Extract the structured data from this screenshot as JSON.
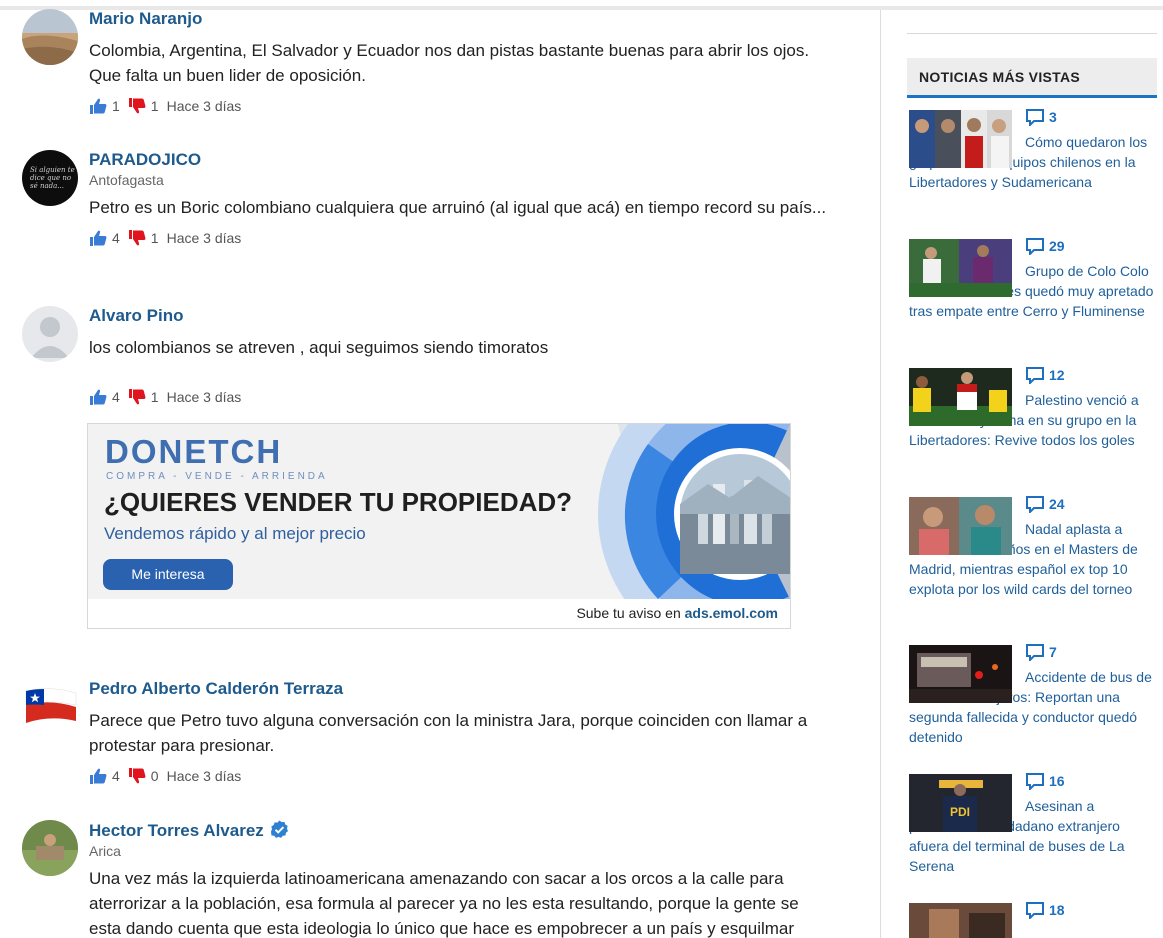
{
  "comments": [
    {
      "name": "Mario Naranjo",
      "location": "",
      "text": "Colombia, Argentina, El Salvador y Ecuador nos dan pistas bastante buenas para abrir los ojos. Que falta un buen lider de oposición.",
      "likes": "1",
      "dislikes": "1",
      "time": "Hace 3 días"
    },
    {
      "name": "PARADOJICO",
      "location": "Antofagasta",
      "text": "Petro es un Boric colombiano cualquiera que arruinó (al igual que acá) en tiempo record su país...",
      "likes": "4",
      "dislikes": "1",
      "time": "Hace 3 días",
      "avatar_text": "Si alguien te dice que no sé nada..."
    },
    {
      "name": "Alvaro Pino",
      "location": "",
      "text": "los colombianos se atreven , aqui seguimos siendo timoratos",
      "likes": "4",
      "dislikes": "1",
      "time": "Hace 3 días"
    },
    {
      "name": "Pedro Alberto Calderón Terraza",
      "location": "",
      "text": "Parece que Petro tuvo alguna conversación con la ministra Jara, porque coinciden con llamar a protestar para presionar.",
      "likes": "4",
      "dislikes": "0",
      "time": "Hace 3 días"
    },
    {
      "name": "Hector Torres Alvarez",
      "location": "Arica",
      "text": "Una vez más la izquierda latinoamericana amenazando con sacar a los orcos a la calle para aterrorizar a la población, esa formula al parecer ya no les esta resultando, porque la gente se esta dando cuenta que esta ideologia lo único que hace es empobrecer a un país y esquilmar",
      "likes": "",
      "dislikes": "",
      "time": ""
    }
  ],
  "ad": {
    "brand": "DONETCH",
    "tagline": "COMPRA - VENDE - ARRIENDA",
    "headline": "¿QUIERES VENDER TU PROPIEDAD?",
    "subline": "Vendemos rápido y al mejor precio",
    "button": "Me interesa",
    "footer_prefix": "Sube tu aviso en",
    "footer_link": "ads.emol.com"
  },
  "sidebar": {
    "title": "NOTICIAS MÁS VISTAS",
    "news": [
      {
        "count": "3",
        "title": "Cómo quedaron los grupos de los equipos chilenos en la Libertadores y Sudamericana"
      },
      {
        "count": "29",
        "title": "Grupo de Colo Colo en la Libertadores quedó muy apretado tras empate entre Cerro y Fluminense"
      },
      {
        "count": "12",
        "title": "Palestino venció a Millonarios y lucha en su grupo en la Libertadores: Revive todos los goles"
      },
      {
        "count": "24",
        "title": "Nadal aplasta a invitado de 16 años en el Masters de Madrid, mientras español ex top 10 explota por los wild cards del torneo"
      },
      {
        "count": "7",
        "title": "Accidente de bus de turistas extranjeros: Reportan una segunda fallecida y conductor quedó detenido"
      },
      {
        "count": "16",
        "title": "Asesinan a puñaladas a ciudadano extranjero afuera del terminal de buses de La Serena",
        "thumb_text": "PDI"
      },
      {
        "count": "18",
        "title": ""
      }
    ]
  },
  "colors": {
    "link": "#1e5a8c",
    "accent": "#1a73c4",
    "like": "#3a7bd5",
    "dislike": "#e0141e"
  },
  "icons": [
    "thumbs-up-icon",
    "thumbs-down-icon",
    "verified-badge-icon",
    "comment-bubble-icon"
  ]
}
